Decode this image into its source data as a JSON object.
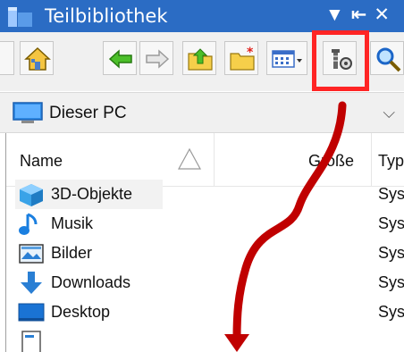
{
  "window": {
    "title": "Teilbibliothek",
    "controls": "▼⇤✕"
  },
  "toolbar": {
    "buttons": [
      "home-icon",
      "back-arrow-icon",
      "forward-arrow-icon",
      "folder-up-icon",
      "new-folder-icon",
      "view-options-icon",
      "filter-settings-icon",
      "search-icon"
    ],
    "highlighted": "filter-settings-icon",
    "highlight_color": "#ff2424"
  },
  "location": {
    "label": "Dieser PC",
    "icon": "computer-icon"
  },
  "columns": {
    "name": "Name",
    "size": "Größe",
    "type": "Typ"
  },
  "rows": [
    {
      "name": "3D-Objekte",
      "type": "Sys",
      "icon": "3d-objects-icon"
    },
    {
      "name": "Musik",
      "type": "Sys",
      "icon": "music-icon"
    },
    {
      "name": "Bilder",
      "type": "Sys",
      "icon": "pictures-icon"
    },
    {
      "name": "Downloads",
      "type": "Sys",
      "icon": "downloads-icon"
    },
    {
      "name": "Desktop",
      "type": "Sys",
      "icon": "desktop-icon"
    }
  ],
  "annotation": {
    "arrow_color": "#c00000"
  }
}
